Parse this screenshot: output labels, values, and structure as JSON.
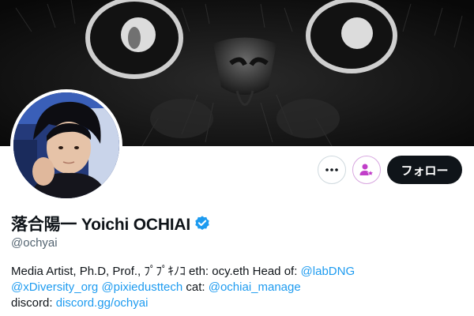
{
  "profile": {
    "display_name": "落合陽一 Yoichi OCHIAI",
    "handle": "@ochyai",
    "verified": true
  },
  "actions": {
    "more_icon": "more-horizontal-icon",
    "subscribe_icon": "person-star-icon",
    "follow_label": "フォロー"
  },
  "bio": {
    "line1": {
      "text": "Media Artist, Ph.D, Prof., ﾌﾟﾌﾟｷﾉｺ eth: ocy.eth Head of: ",
      "link1": "@labDNG"
    },
    "line2": {
      "link1": "@xDiversity_org",
      "link2": "@pixiedusttech",
      "text": " cat: ",
      "link3": "@ochiai_manage"
    },
    "line3": {
      "text": "discord: ",
      "link1": "discord.gg/ochyai"
    }
  },
  "colors": {
    "accent": "#1d9bf0",
    "text": "#0f1419",
    "muted": "#536471",
    "follow_bg": "#0f1419",
    "subscribe": "#c13fc9"
  }
}
